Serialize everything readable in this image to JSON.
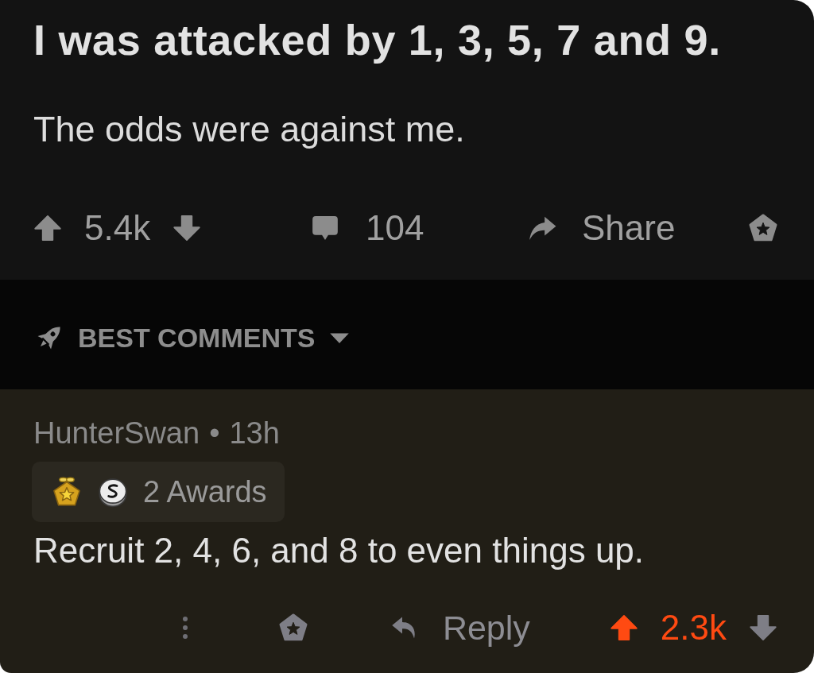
{
  "post": {
    "title": "I was attacked by 1, 3, 5, 7 and 9.",
    "body": "The odds were against me.",
    "vote": {
      "score": "5.4k",
      "upvoted": false
    },
    "comment_count": "104",
    "share_label": "Share"
  },
  "sort": {
    "label": "BEST COMMENTS"
  },
  "comments": [
    {
      "author": "HunterSwan",
      "separator": "•",
      "age": "13h",
      "awards": [
        {
          "kind": "gold"
        },
        {
          "kind": "silver"
        }
      ],
      "awards_label": "2 Awards",
      "text": "Recruit 2, 4, 6, and 8 to even things up.",
      "reply_label": "Reply",
      "vote": {
        "score": "2.3k",
        "upvoted": true
      }
    }
  ]
}
